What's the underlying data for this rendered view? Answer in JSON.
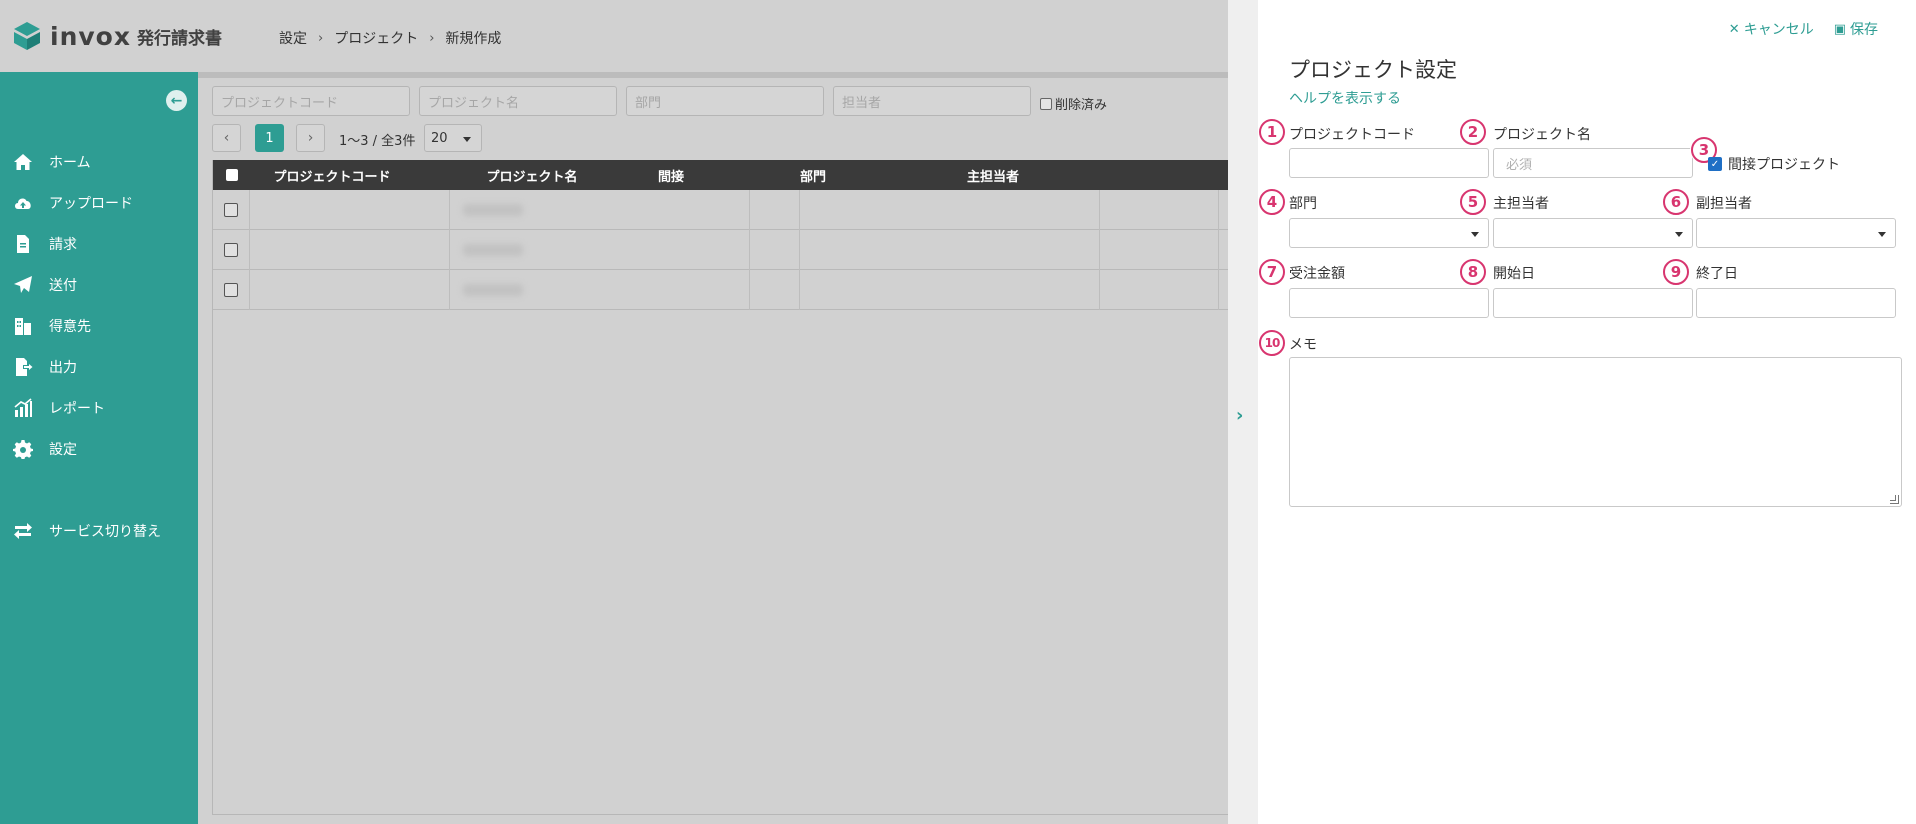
{
  "header": {
    "logo_text": "invox",
    "product_name": "発行請求書",
    "breadcrumb": [
      "設定",
      "プロジェクト",
      "新規作成"
    ],
    "breadcrumb_separator": "›"
  },
  "sidebar": {
    "collapse_icon": "arrow-left-circle-icon",
    "items": [
      {
        "label": "ホーム",
        "icon": "home-icon"
      },
      {
        "label": "アップロード",
        "icon": "cloud-upload-icon"
      },
      {
        "label": "請求",
        "icon": "document-icon"
      },
      {
        "label": "送付",
        "icon": "send-icon"
      },
      {
        "label": "得意先",
        "icon": "building-icon"
      },
      {
        "label": "出力",
        "icon": "export-icon"
      },
      {
        "label": "レポート",
        "icon": "chart-icon"
      },
      {
        "label": "設定",
        "icon": "gear-icon"
      },
      {
        "label": "サービス切り替え",
        "icon": "switch-icon"
      }
    ],
    "accent_color": "#2e9d93"
  },
  "list": {
    "filters": {
      "project_code_placeholder": "プロジェクトコード",
      "project_name_placeholder": "プロジェクト名",
      "department_placeholder": "部門",
      "person_placeholder": "担当者",
      "deleted_label": "削除済み"
    },
    "pager": {
      "prev": "‹",
      "current_page": "1",
      "next": "›",
      "range_text": "1〜3 / 全3件",
      "per_page": "20"
    },
    "columns": [
      "プロジェクトコード",
      "プロジェクト名",
      "間接",
      "部門",
      "主担当者"
    ],
    "row_count": 3
  },
  "drawer": {
    "collapse_icon": "chevron-right-icon",
    "cancel_label": "キャンセル",
    "save_label": "保存",
    "title": "プロジェクト設定",
    "help_link": "ヘルプを表示する",
    "fields": {
      "project_code": {
        "badge": "1",
        "label": "プロジェクトコード",
        "value": ""
      },
      "project_name": {
        "badge": "2",
        "label": "プロジェクト名",
        "placeholder": "必須",
        "value": ""
      },
      "indirect": {
        "badge": "3",
        "label": "間接プロジェクト",
        "checked": true
      },
      "department": {
        "badge": "4",
        "label": "部門",
        "value": ""
      },
      "main_person": {
        "badge": "5",
        "label": "主担当者",
        "value": ""
      },
      "sub_person": {
        "badge": "6",
        "label": "副担当者",
        "value": ""
      },
      "order_amount": {
        "badge": "7",
        "label": "受注金額",
        "value": ""
      },
      "start_date": {
        "badge": "8",
        "label": "開始日",
        "value": ""
      },
      "end_date": {
        "badge": "9",
        "label": "終了日",
        "value": ""
      },
      "memo": {
        "badge": "10",
        "label": "メモ",
        "value": ""
      }
    },
    "badge_color": "#d8356f"
  }
}
